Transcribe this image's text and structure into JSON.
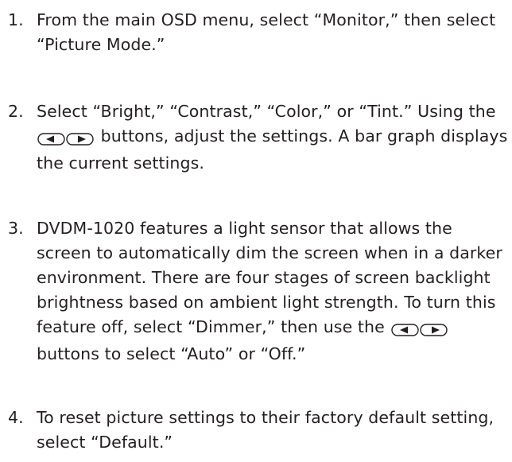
{
  "steps": [
    {
      "number": "1.",
      "text": "From the main OSD menu, select “Monitor,” then select “Picture Mode.”"
    },
    {
      "number": "2.",
      "text_before": "Select “Bright,” “Contrast,” “Color,” or “Tint.” Using the",
      "text_after": "buttons, adjust the settings. A bar graph displays the current settings."
    },
    {
      "number": "3.",
      "text_before": "DVDM-1020 features a light sensor that allows the screen to automatically dim the screen when in a darker environment. There are four stages of screen backlight brightness based on ambient light strength. To turn this feature off, select “Dimmer,” then use the",
      "text_after": "buttons to select “Auto” or “Off.”"
    },
    {
      "number": "4.",
      "text": "To reset picture settings to their factory default setting, select “Default.”"
    }
  ],
  "icons": {
    "left_button": "left-arrow-button-icon",
    "right_button": "right-arrow-button-icon"
  },
  "colors": {
    "text": "#231f20",
    "background": "#ffffff"
  }
}
